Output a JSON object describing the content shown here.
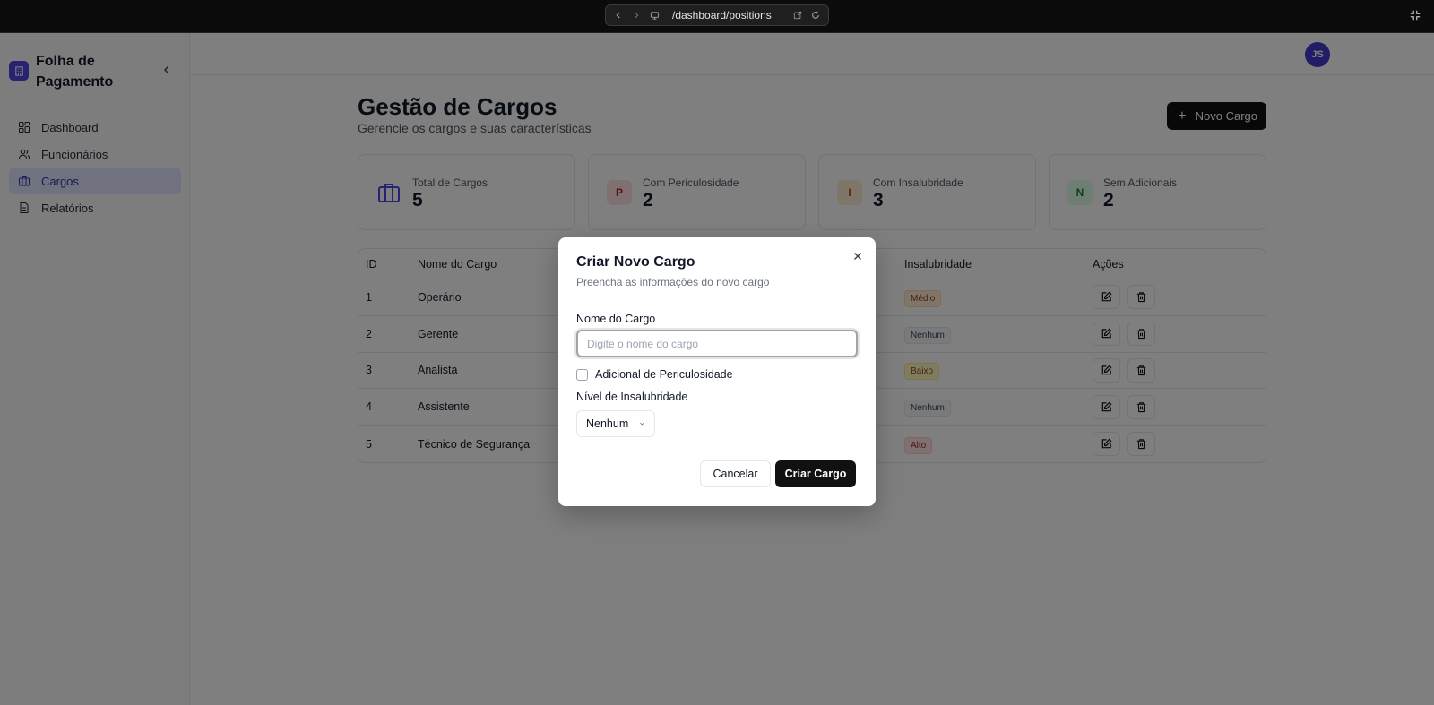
{
  "browser": {
    "url": "/dashboard/positions"
  },
  "sidebar": {
    "brand_title": "Folha de Pagamento",
    "items": [
      {
        "label": "Dashboard",
        "icon": "dashboard-icon"
      },
      {
        "label": "Funcionários",
        "icon": "users-icon"
      },
      {
        "label": "Cargos",
        "icon": "briefcase-icon",
        "active": true
      },
      {
        "label": "Relatórios",
        "icon": "file-icon"
      }
    ]
  },
  "header": {
    "avatar_initials": "JS"
  },
  "page": {
    "title": "Gestão de Cargos",
    "subtitle": "Gerencie os cargos e suas características",
    "new_button_label": "Novo Cargo"
  },
  "stats": [
    {
      "label": "Total de Cargos",
      "value": "5",
      "icon": "briefcase-icon"
    },
    {
      "label": "Com Periculosidade",
      "value": "2",
      "icon_letter": "P",
      "color": "#fee2e2"
    },
    {
      "label": "Com Insalubridade",
      "value": "3",
      "icon_letter": "I",
      "color": "#ffedd5"
    },
    {
      "label": "Sem Adicionais",
      "value": "2",
      "icon_letter": "N",
      "color": "#dcfce7"
    }
  ],
  "table": {
    "headers": {
      "id": "ID",
      "name": "Nome do Cargo",
      "insalubrity": "Insalubridade",
      "actions": "Ações"
    },
    "rows": [
      {
        "id": "1",
        "name": "Operário",
        "insalubrity": "Médio"
      },
      {
        "id": "2",
        "name": "Gerente",
        "insalubrity": "Nenhum"
      },
      {
        "id": "3",
        "name": "Analista",
        "insalubrity": "Baixo"
      },
      {
        "id": "4",
        "name": "Assistente",
        "insalubrity": "Nenhum"
      },
      {
        "id": "5",
        "name": "Técnico de Segurança",
        "insalubrity": "Alto"
      }
    ]
  },
  "modal": {
    "title": "Criar Novo Cargo",
    "description": "Preencha as informações do novo cargo",
    "name_label": "Nome do Cargo",
    "name_placeholder": "Digite o nome do cargo",
    "name_value": "",
    "hazard_label": "Adicional de Periculosidade",
    "hazard_checked": false,
    "insalubrity_label": "Nível de Insalubridade",
    "insalubrity_value": "Nenhum",
    "cancel_label": "Cancelar",
    "create_label": "Criar Cargo"
  },
  "colors": {
    "accent": "#4f46e5",
    "primary_button": "#111111"
  }
}
